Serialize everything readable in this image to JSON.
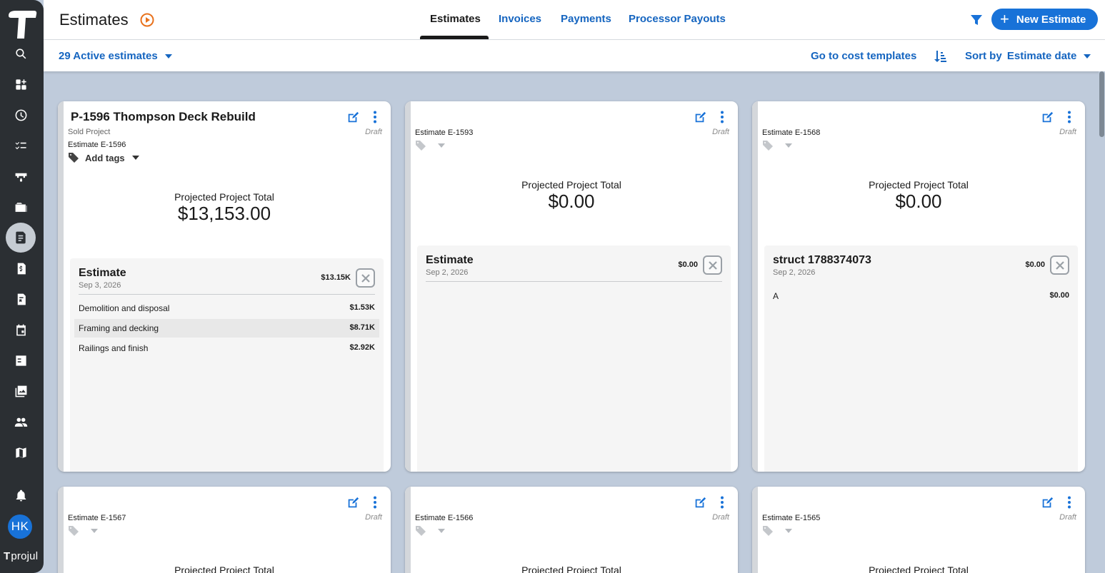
{
  "app": {
    "brand": "projul",
    "user_initials": "HK"
  },
  "header": {
    "title": "Estimates",
    "tabs": [
      "Estimates",
      "Invoices",
      "Payments",
      "Processor Payouts"
    ],
    "active_tab": "Estimates",
    "new_button": "New Estimate"
  },
  "subbar": {
    "active_estimates": "29 Active estimates",
    "cost_templates": "Go to cost templates",
    "sort_label": "Sort by",
    "sort_value": "Estimate date"
  },
  "colors": {
    "accent": "#1872d8",
    "link": "#1565c0",
    "sidebar": "#2b2f33",
    "background": "#bfcbdb",
    "play_icon": "#e8711c"
  },
  "sidebar_icons": [
    "search-icon",
    "dashboard-add-icon",
    "clock-icon",
    "checklist-icon",
    "tools-icon",
    "folder-icon",
    "estimate-icon",
    "invoice-icon",
    "purchase-order-icon",
    "calendar-icon",
    "task-icon",
    "photos-icon",
    "people-icon",
    "map-icon",
    "bell-icon"
  ],
  "cards": [
    {
      "title": "P-1596 Thompson Deck Rebuild",
      "subtitle": "Sold Project",
      "estimate_no": "Estimate E-1596",
      "status": "Draft",
      "tags_label": "Add tags",
      "total_label": "Projected Project Total",
      "total": "$13,153.00",
      "panel": {
        "name": "Estimate",
        "date": "Sep 3, 2026",
        "amount": "$13.15K",
        "lines": [
          {
            "name": "Demolition and disposal",
            "value": "$1.53K"
          },
          {
            "name": "Framing and decking",
            "value": "$8.71K"
          },
          {
            "name": "Railings and finish",
            "value": "$2.92K"
          }
        ]
      }
    },
    {
      "estimate_no": "Estimate E-1593",
      "status": "Draft",
      "total_label": "Projected Project Total",
      "total": "$0.00",
      "panel": {
        "name": "Estimate",
        "date": "Sep 2, 2026",
        "amount": "$0.00",
        "lines": []
      }
    },
    {
      "estimate_no": "Estimate E-1568",
      "status": "Draft",
      "total_label": "Projected Project Total",
      "total": "$0.00",
      "panel": {
        "name": "struct 1788374073",
        "date": "Sep 2, 2026",
        "amount": "$0.00",
        "lines": [
          {
            "name": "A",
            "value": "$0.00"
          }
        ]
      }
    },
    {
      "estimate_no": "Estimate E-1567",
      "status": "Draft",
      "total_label": "Projected Project Total"
    },
    {
      "estimate_no": "Estimate E-1566",
      "status": "Draft",
      "total_label": "Projected Project Total"
    },
    {
      "estimate_no": "Estimate E-1565",
      "status": "Draft",
      "total_label": "Projected Project Total"
    }
  ]
}
